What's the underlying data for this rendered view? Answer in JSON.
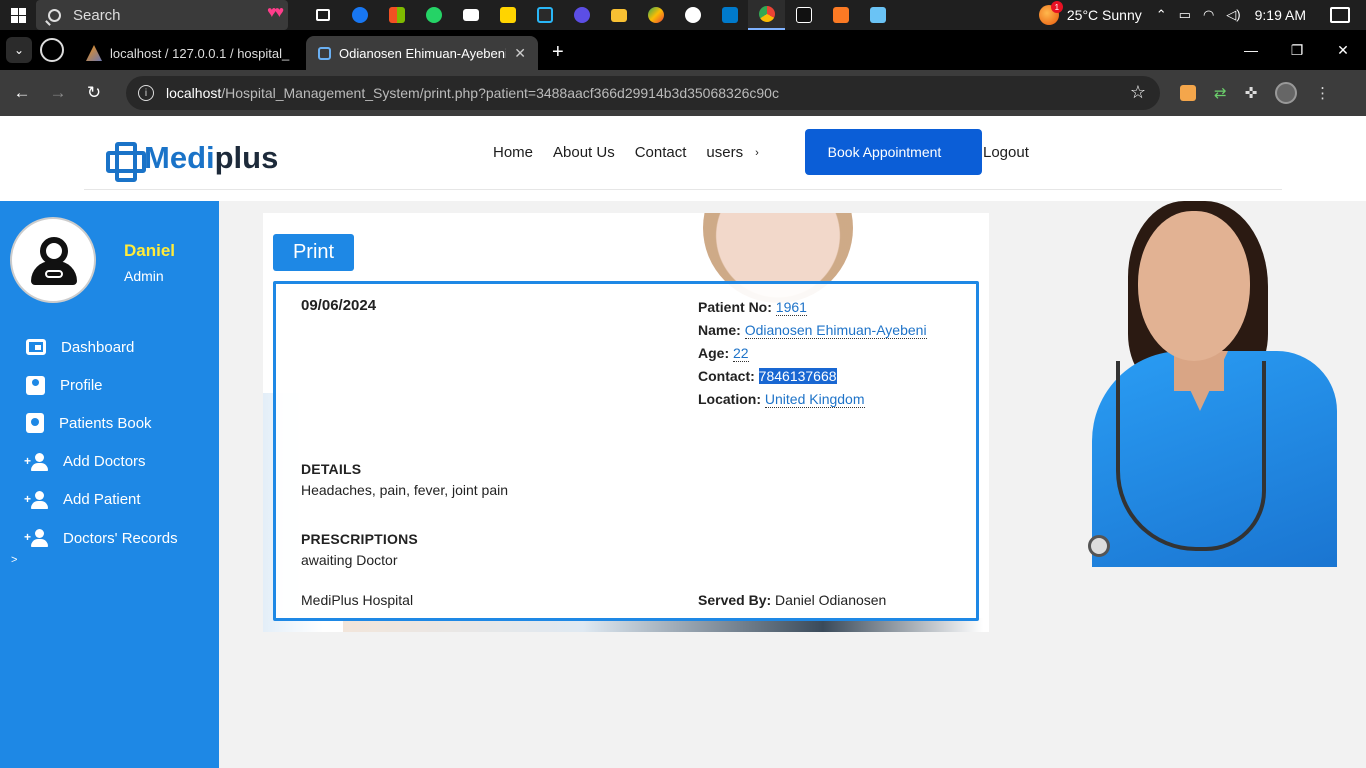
{
  "taskbar": {
    "search_placeholder": "Search",
    "weather": "25°C  Sunny",
    "weather_badge": "1",
    "time": "9:19 AM"
  },
  "browser": {
    "tabs": [
      {
        "title": "localhost / 127.0.0.1 / hospital_"
      },
      {
        "title": "Odianosen Ehimuan-Ayebeni - "
      }
    ],
    "url_host": "localhost",
    "url_path": "/Hospital_Management_System/print.php?patient=3488aacf366d29914b3d35068326c90c"
  },
  "site": {
    "logo_medi": "Medi",
    "logo_plus": "plus",
    "nav": {
      "home": "Home",
      "about": "About Us",
      "contact": "Contact",
      "users": "users",
      "users_chev": "›",
      "book": "Book Appointment",
      "logout": "Logout"
    }
  },
  "sidebar": {
    "name": "Daniel",
    "role": "Admin",
    "items": [
      {
        "label": "Dashboard"
      },
      {
        "label": "Profile"
      },
      {
        "label": "Patients Book"
      },
      {
        "label": "Add Doctors"
      },
      {
        "label": "Add Patient"
      },
      {
        "label": "Doctors' Records"
      }
    ],
    "caret": ">"
  },
  "record": {
    "print_label": "Print",
    "date": "09/06/2024",
    "patient_no_label": "Patient No:",
    "patient_no": "1961",
    "name_label": "Name:",
    "name": "Odianosen Ehimuan-Ayebeni",
    "age_label": "Age:",
    "age": "22",
    "contact_label": "Contact:",
    "contact": "7846137668",
    "location_label": "Location:",
    "location": "United Kingdom",
    "details_title": "DETAILS",
    "details": "Headaches, pain, fever, joint pain",
    "prescriptions_title": "PRESCRIPTIONS",
    "prescriptions": "awaiting Doctor",
    "hospital": "MediPlus Hospital",
    "served_label": "Served By:",
    "served_by": "Daniel Odianosen"
  },
  "colors": {
    "brand_blue": "#1e88e5",
    "button_blue": "#0b5ed7",
    "admin_name_yellow": "#ffeb3b"
  }
}
